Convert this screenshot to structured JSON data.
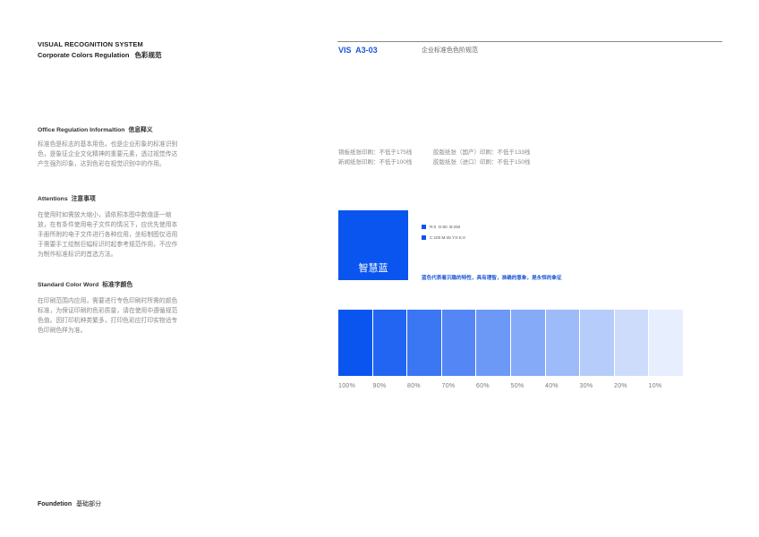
{
  "header": {
    "title": "VISUAL RECOGNITION SYSTEM",
    "subtitle_en": "Corporate Colors Regulation",
    "subtitle_cn": "色彩规范",
    "code": "VIS  A3-03",
    "code_desc": "企业标准色色阶规范"
  },
  "sections": [
    {
      "title_en": "Office Regulation Informaltion",
      "title_cn": "信息释义",
      "body": "标准色是标志的基本用色，也是企业形象的标准识别色，是象征企业文化精神的重要元素，透过视觉传达产生强烈印象，达到色彩在视觉识别中的作用。"
    },
    {
      "title_en": "Attentions",
      "title_cn": "注意事项",
      "body": "在使用时如需放大缩小，请依照本图中数值逐一缩放，在有条件使用电子文件的情况下，应优先使用本手册所附的电子文件进行各种应用，坐标制图仅适用于需要手工绘制巨幅标识时起参考规范作用，不应作为制作标准标识的首选方法。"
    },
    {
      "title_en": "Standard Color Word",
      "title_cn": "标准字颜色",
      "body": "在印刷范围内应用，需要进行专色印刷时所需的颜色标准，为保证印刷的色彩质量，请在使用中遵循规范色值。因打印机种类繁多，打印色彩应打印实物适专色印刷色样为准。"
    }
  ],
  "print_specs": [
    "铜板纸张印刷：不低于175线",
    "胶版纸张（国产）印刷：不低于133线",
    "新闻纸张印刷：不低于100线",
    "胶版纸张（进口）印刷：不低于150线"
  ],
  "color": {
    "name": "智慧蓝",
    "hex": "#0a55f0",
    "rgb": "R:0  G:80  B:250",
    "cmyk": "C:100 M:45 Y:0 K:0",
    "description": "蓝色代表着沉稳的特性，具有理智，准确的意象，是永恒的象征"
  },
  "tints": [
    {
      "label": "100%",
      "value": 1.0,
      "color": "#0a55f0"
    },
    {
      "label": "90%",
      "value": 0.9,
      "color": "#2265f2"
    },
    {
      "label": "80%",
      "value": 0.8,
      "color": "#3b76f3"
    },
    {
      "label": "70%",
      "value": 0.7,
      "color": "#5487f5"
    },
    {
      "label": "60%",
      "value": 0.6,
      "color": "#6c98f6"
    },
    {
      "label": "50%",
      "value": 0.5,
      "color": "#85aaf8"
    },
    {
      "label": "40%",
      "value": 0.4,
      "color": "#9dbbf9"
    },
    {
      "label": "30%",
      "value": 0.3,
      "color": "#b6ccfa"
    },
    {
      "label": "20%",
      "value": 0.2,
      "color": "#cedcfc"
    },
    {
      "label": "10%",
      "value": 0.1,
      "color": "#e7eefe"
    }
  ],
  "footer": {
    "en": "Foundetion",
    "cn": "基础部分"
  }
}
